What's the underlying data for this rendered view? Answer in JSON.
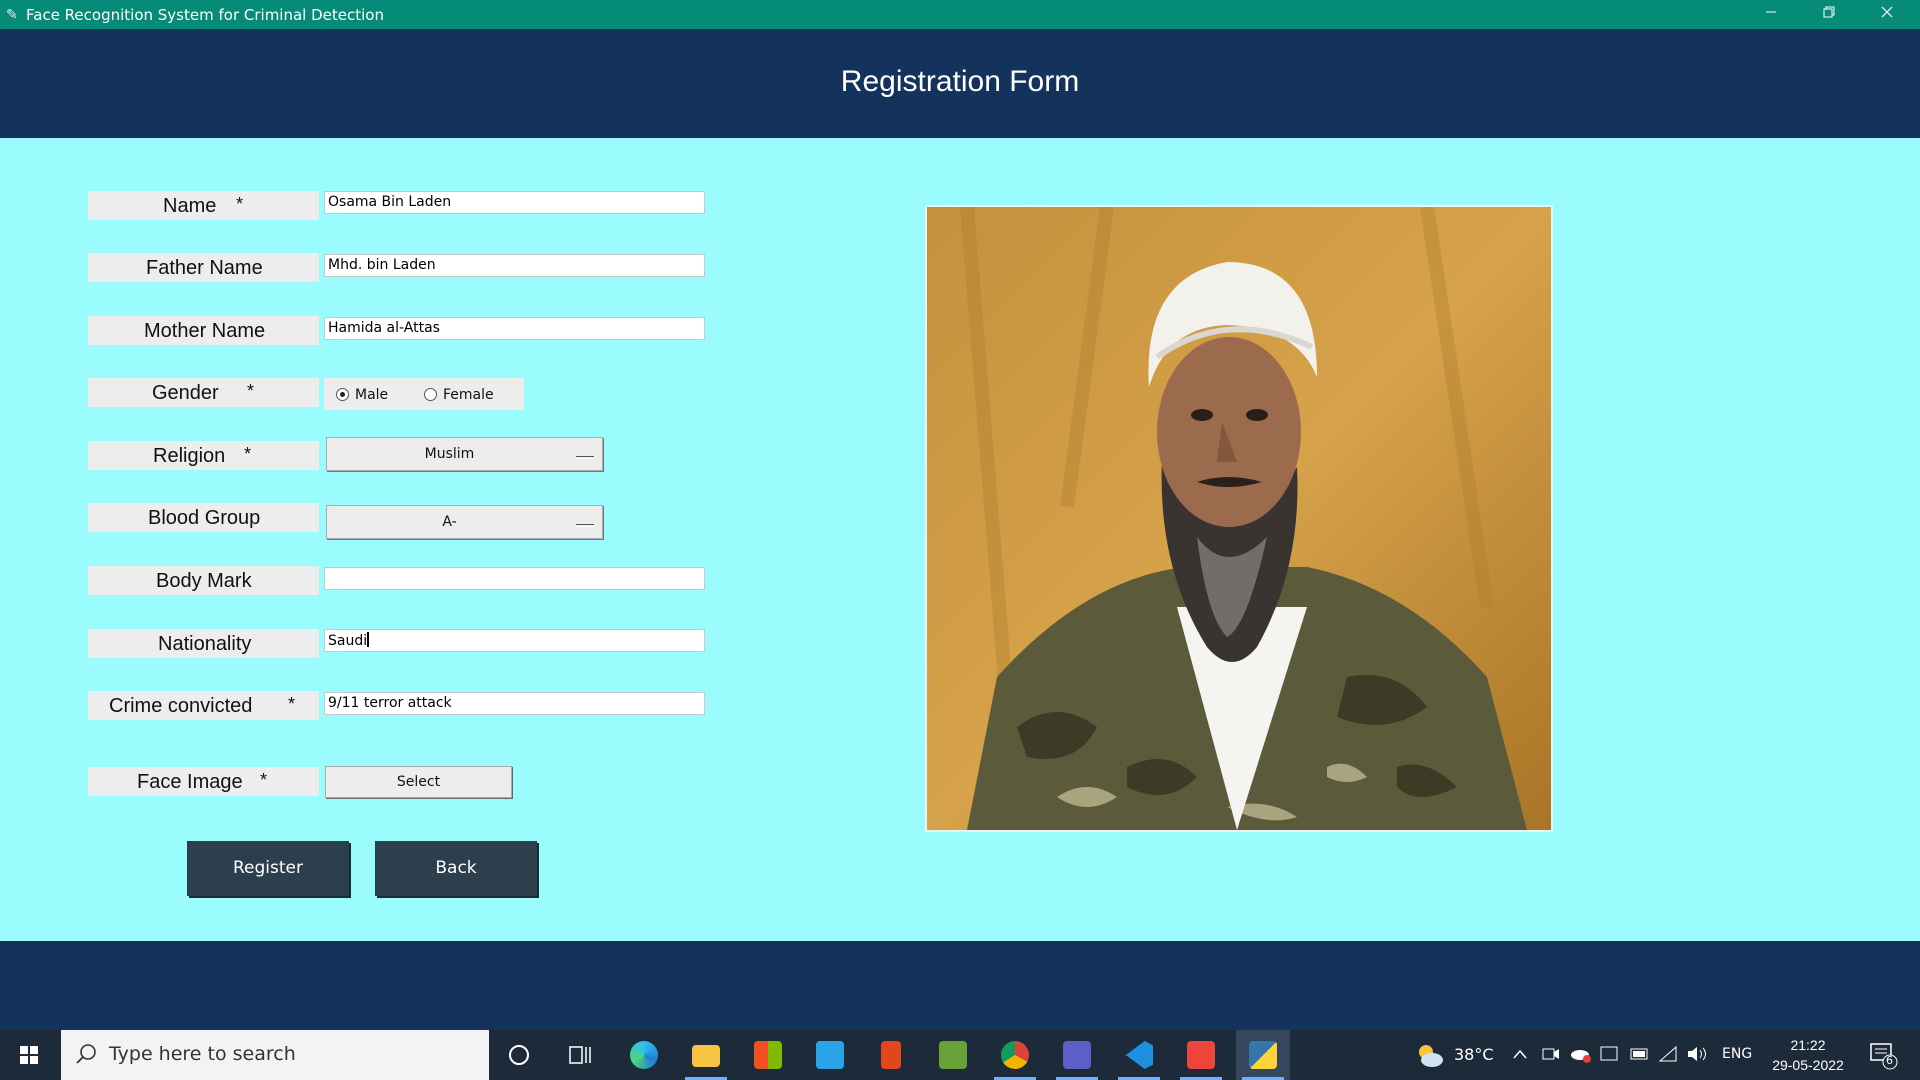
{
  "window": {
    "title": "Face Recognition System for Criminal Detection",
    "minimize_icon": "minimize-icon",
    "maximize_icon": "restore-icon",
    "close_icon": "close-icon"
  },
  "header": {
    "title": "Registration Form"
  },
  "form": {
    "name": {
      "label": "Name",
      "required": "*",
      "value": "Osama Bin Laden"
    },
    "father_name": {
      "label": "Father Name",
      "value": "Mhd. bin Laden"
    },
    "mother_name": {
      "label": "Mother Name",
      "value": "Hamida al-Attas"
    },
    "gender": {
      "label": "Gender",
      "required": "*",
      "options": [
        "Male",
        "Female"
      ],
      "selected": "Male"
    },
    "religion": {
      "label": "Religion",
      "required": "*",
      "value": "Muslim"
    },
    "blood_group": {
      "label": "Blood Group",
      "value": "A-"
    },
    "body_mark": {
      "label": "Body Mark",
      "value": ""
    },
    "nationality": {
      "label": "Nationality",
      "value": "Saudi"
    },
    "crime": {
      "label": "Crime convicted",
      "required": "*",
      "value": "9/11 terror attack"
    },
    "face_image": {
      "label": "Face Image",
      "required": "*",
      "button": "Select"
    }
  },
  "actions": {
    "register": "Register",
    "back": "Back"
  },
  "taskbar": {
    "search_placeholder": "Type here to search",
    "weather_temp": "38°C",
    "language": "ENG",
    "time": "21:22",
    "date": "29-05-2022",
    "notification_count": "6"
  },
  "colors": {
    "title_bar": "#058b77",
    "header": "#14335c",
    "background": "#9afcfd",
    "button": "#2b3f4d"
  }
}
